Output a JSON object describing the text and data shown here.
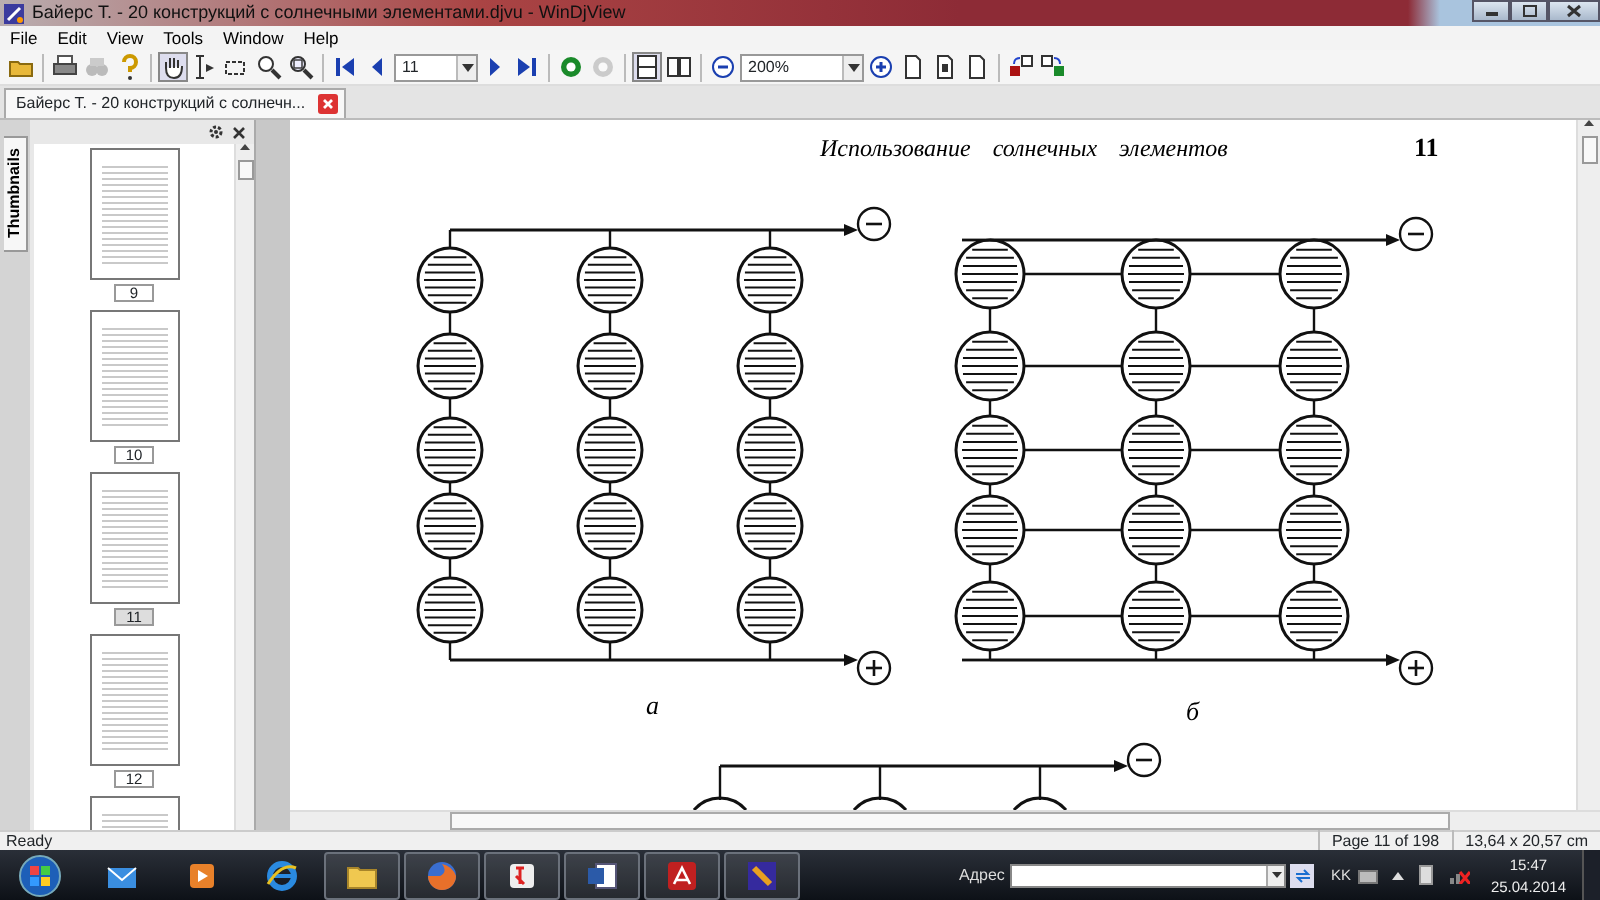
{
  "window": {
    "title": "Байерс Т. - 20 конструкций с солнечными элементами.djvu - WinDjView"
  },
  "menu": [
    "File",
    "Edit",
    "View",
    "Tools",
    "Window",
    "Help"
  ],
  "toolbar": {
    "tools": [
      {
        "kind": "hand",
        "selected": true
      },
      {
        "kind": "select-text",
        "selected": false
      },
      {
        "kind": "select-rect",
        "selected": false
      },
      {
        "kind": "zoom",
        "selected": false
      },
      {
        "kind": "zoom-rect",
        "selected": false
      }
    ],
    "page_field": {
      "value": "11"
    },
    "history": [
      {
        "kind": "back",
        "disabled": false
      },
      {
        "kind": "forward",
        "disabled": true
      }
    ],
    "layouts": [
      {
        "kind": "single",
        "selected": true
      },
      {
        "kind": "facing",
        "selected": false
      }
    ],
    "zoom_field": {
      "value": "200%"
    }
  },
  "tabs": [
    {
      "label": "Байерс Т. - 20 конструкций с солнечн...",
      "selected": true
    }
  ],
  "sidebar": {
    "tab": "Thumbnails",
    "thumbnails": [
      {
        "label": "9",
        "selected": false
      },
      {
        "label": "10",
        "selected": false
      },
      {
        "label": "11",
        "selected": true
      },
      {
        "label": "12",
        "selected": false
      }
    ]
  },
  "document": {
    "header": "Использование солнечных элементов",
    "page_number": "11",
    "figures": [
      {
        "kind": "series",
        "label": "а"
      },
      {
        "kind": "mesh",
        "label": "б"
      },
      {
        "kind": "series-partial"
      }
    ]
  },
  "status_bar": {
    "message": "Ready",
    "page": "Page 11 of 198",
    "size": "13,64 x 20,57 cm"
  },
  "taskbar": {
    "apps": [
      {
        "kind": "mail",
        "running": false
      },
      {
        "kind": "media",
        "running": false
      },
      {
        "kind": "ie",
        "running": false
      },
      {
        "kind": "folder",
        "running": true
      },
      {
        "kind": "firefox",
        "running": true
      },
      {
        "kind": "yandex",
        "running": true
      },
      {
        "kind": "word",
        "running": true
      },
      {
        "kind": "acrobat",
        "running": true
      },
      {
        "kind": "djview",
        "running": true
      }
    ],
    "address_label": "Адрес",
    "language": "KK",
    "time": "15:47",
    "date": "25.04.2014"
  }
}
